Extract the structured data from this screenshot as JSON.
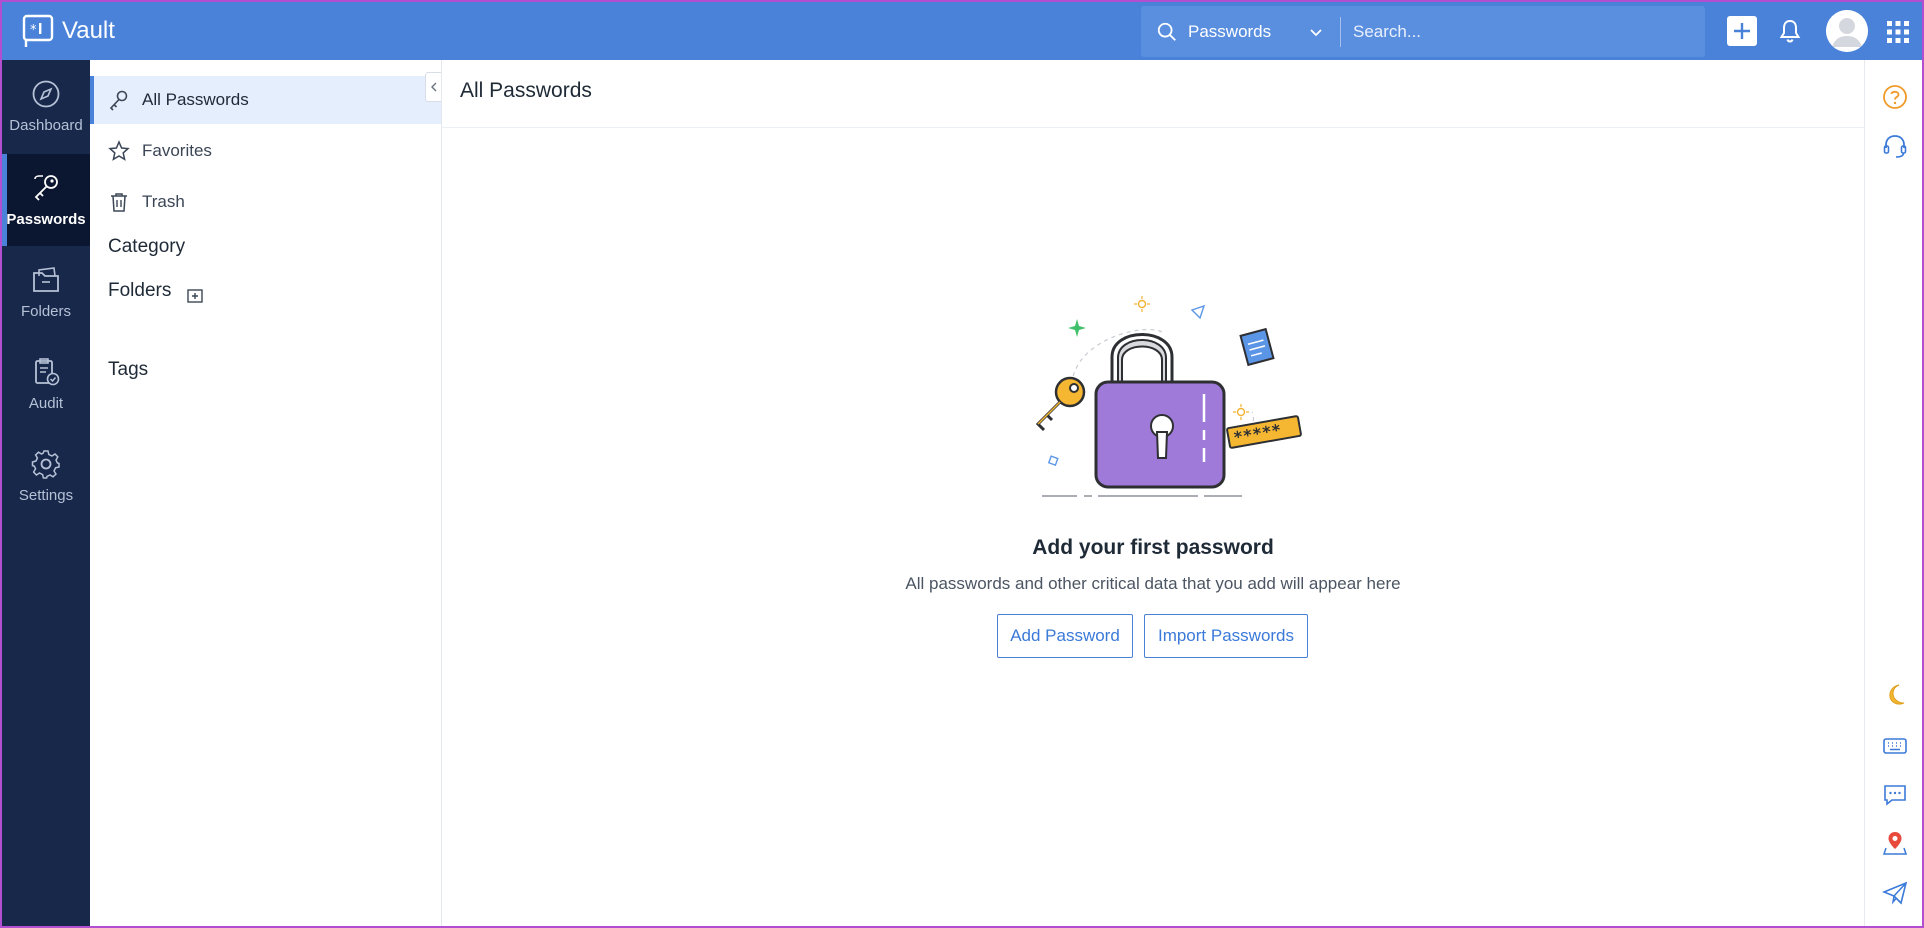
{
  "app": {
    "name": "Vault"
  },
  "search": {
    "scope": "Passwords",
    "placeholder": "Search..."
  },
  "rail": {
    "items": [
      {
        "label": "Dashboard",
        "icon": "compass-icon"
      },
      {
        "label": "Passwords",
        "icon": "keys-icon",
        "active": true
      },
      {
        "label": "Folders",
        "icon": "folder-icon"
      },
      {
        "label": "Audit",
        "icon": "clipboard-check-icon"
      },
      {
        "label": "Settings",
        "icon": "gear-icon"
      }
    ]
  },
  "sidebar": {
    "items": [
      {
        "label": "All Passwords",
        "icon": "key-icon",
        "active": true
      },
      {
        "label": "Favorites",
        "icon": "star-icon"
      },
      {
        "label": "Trash",
        "icon": "trash-icon"
      }
    ],
    "category_heading": "Category",
    "folders_heading": "Folders",
    "tags_heading": "Tags"
  },
  "main": {
    "title": "All Passwords",
    "empty_state": {
      "title": "Add your first password",
      "subtitle": "All passwords and other critical data that you add will appear here",
      "add_button": "Add Password",
      "import_button": "Import Passwords"
    }
  },
  "colors": {
    "topbar": "#4a82da",
    "rail": "#17284a",
    "accent": "#3b7ad9",
    "lock_body": "#9f7ad8"
  }
}
